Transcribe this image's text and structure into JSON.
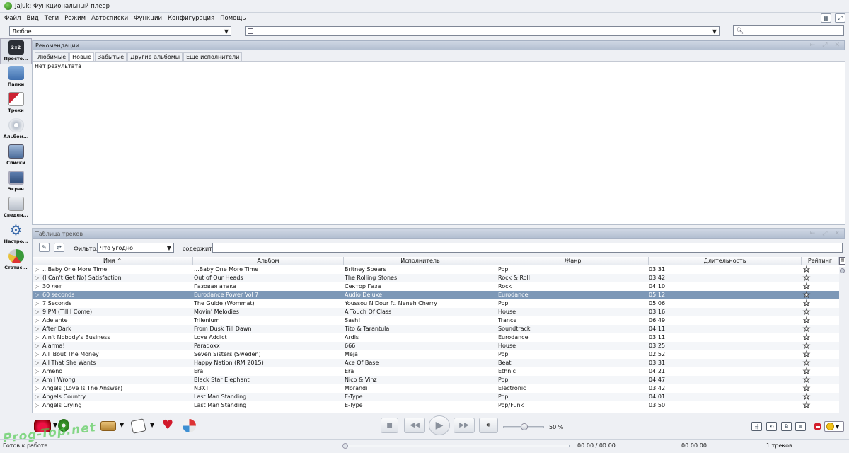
{
  "window": {
    "title": "Jajuk: Функциональный плеер"
  },
  "menu": [
    "Файл",
    "Вид",
    "Теги",
    "Режим",
    "Автосписки",
    "Функции",
    "Конфигурация",
    "Помощь"
  ],
  "toolbar": {
    "ambience_value": "Любое",
    "history_value": "",
    "search_placeholder": ""
  },
  "sidebar": [
    {
      "label": "Просто...",
      "icon": "simple-view-icon"
    },
    {
      "label": "Папки",
      "icon": "folder-icon"
    },
    {
      "label": "Треки",
      "icon": "tracks-icon"
    },
    {
      "label": "Альбом...",
      "icon": "album-icon"
    },
    {
      "label": "Списки",
      "icon": "playlist-icon"
    },
    {
      "label": "Экран",
      "icon": "display-icon"
    },
    {
      "label": "Сведен...",
      "icon": "info-icon"
    },
    {
      "label": "Настро...",
      "icon": "settings-icon"
    },
    {
      "label": "Статис...",
      "icon": "stats-icon"
    }
  ],
  "suggestions": {
    "title": "Рекомендации",
    "tabs": [
      "Любимые",
      "Новые",
      "Забытые",
      "Другие альбомы",
      "Еще исполнители"
    ],
    "selected_tab": 1,
    "empty_text": "Нет результата"
  },
  "tracks": {
    "title": "Таблица треков",
    "filter_label": "Фильтр:",
    "filter_value": "Что угодно",
    "contains_label": "содержит:",
    "filter_text": "",
    "columns": [
      "Имя ^",
      "Альбом",
      "Исполнитель",
      "Жанр",
      "Длительность",
      "Рейтинг"
    ],
    "selected_row": 3,
    "rows": [
      {
        "name": "...Baby One More Time",
        "album": "...Baby One More Time",
        "artist": "Britney Spears",
        "genre": "Pop",
        "duration": "03:31"
      },
      {
        "name": "(I Can't Get No) Satisfaction",
        "album": "Out of Our Heads",
        "artist": "The Rolling Stones",
        "genre": "Rock & Roll",
        "duration": "03:42"
      },
      {
        "name": "30 лет",
        "album": "Газовая атака",
        "artist": "Сектор Газа",
        "genre": "Rock",
        "duration": "04:10"
      },
      {
        "name": "60 seconds",
        "album": "Eurodance Power Vol 7",
        "artist": "Audio Deluxe",
        "genre": "Eurodance",
        "duration": "05:12"
      },
      {
        "name": "7 Seconds",
        "album": "The Guide (Wommat)",
        "artist": "Youssou N'Dour ft. Neneh Cherry",
        "genre": "Pop",
        "duration": "05:06"
      },
      {
        "name": "9 PM (Till I Come)",
        "album": "Movin' Melodies",
        "artist": "A Touch Of Class",
        "genre": "House",
        "duration": "03:16"
      },
      {
        "name": "Adelante",
        "album": "Trilenium",
        "artist": "Sash!",
        "genre": "Trance",
        "duration": "06:49"
      },
      {
        "name": "After Dark",
        "album": "From Dusk Till Dawn",
        "artist": "Tito & Tarantula",
        "genre": "Soundtrack",
        "duration": "04:11"
      },
      {
        "name": "Ain't Nobody's Business",
        "album": "Love Addict",
        "artist": "Ardis",
        "genre": "Eurodance",
        "duration": "03:11"
      },
      {
        "name": "Alarma!",
        "album": "Paradoxx",
        "artist": "666",
        "genre": "House",
        "duration": "03:25"
      },
      {
        "name": "All 'Bout The Money",
        "album": "Seven Sisters (Sweden)",
        "artist": "Meja",
        "genre": "Pop",
        "duration": "02:52"
      },
      {
        "name": "All That She Wants",
        "album": "Happy Nation (RM 2015)",
        "artist": "Ace Of Base",
        "genre": "Beat",
        "duration": "03:31"
      },
      {
        "name": "Ameno",
        "album": "Era",
        "artist": "Era",
        "genre": "Ethnic",
        "duration": "04:21"
      },
      {
        "name": "Am I Wrong",
        "album": "Black Star Elephant",
        "artist": "Nico & Vinz",
        "genre": "Pop",
        "duration": "04:47"
      },
      {
        "name": "Angels (Love Is The Answer)",
        "album": "N3XT",
        "artist": "Morandi",
        "genre": "Electronic",
        "duration": "03:42"
      },
      {
        "name": "Angels Country",
        "album": "Last Man Standing",
        "artist": "E-Type",
        "genre": "Pop",
        "duration": "04:01"
      },
      {
        "name": "Angels Crying",
        "album": "Last Man Standing",
        "artist": "E-Type",
        "genre": "Pop/Funk",
        "duration": "03:50"
      }
    ]
  },
  "player": {
    "volume_label": "50 %",
    "volume": 0.5,
    "position": 0.0
  },
  "status": {
    "text": "Готов к работе",
    "time": "00:00 / 00:00",
    "remaining": "00:00:00",
    "track_count": "1 треков"
  },
  "watermark": "Prog-Top.net",
  "colors": {
    "accent": "#7d98b7",
    "header": "#b3bfd1"
  }
}
